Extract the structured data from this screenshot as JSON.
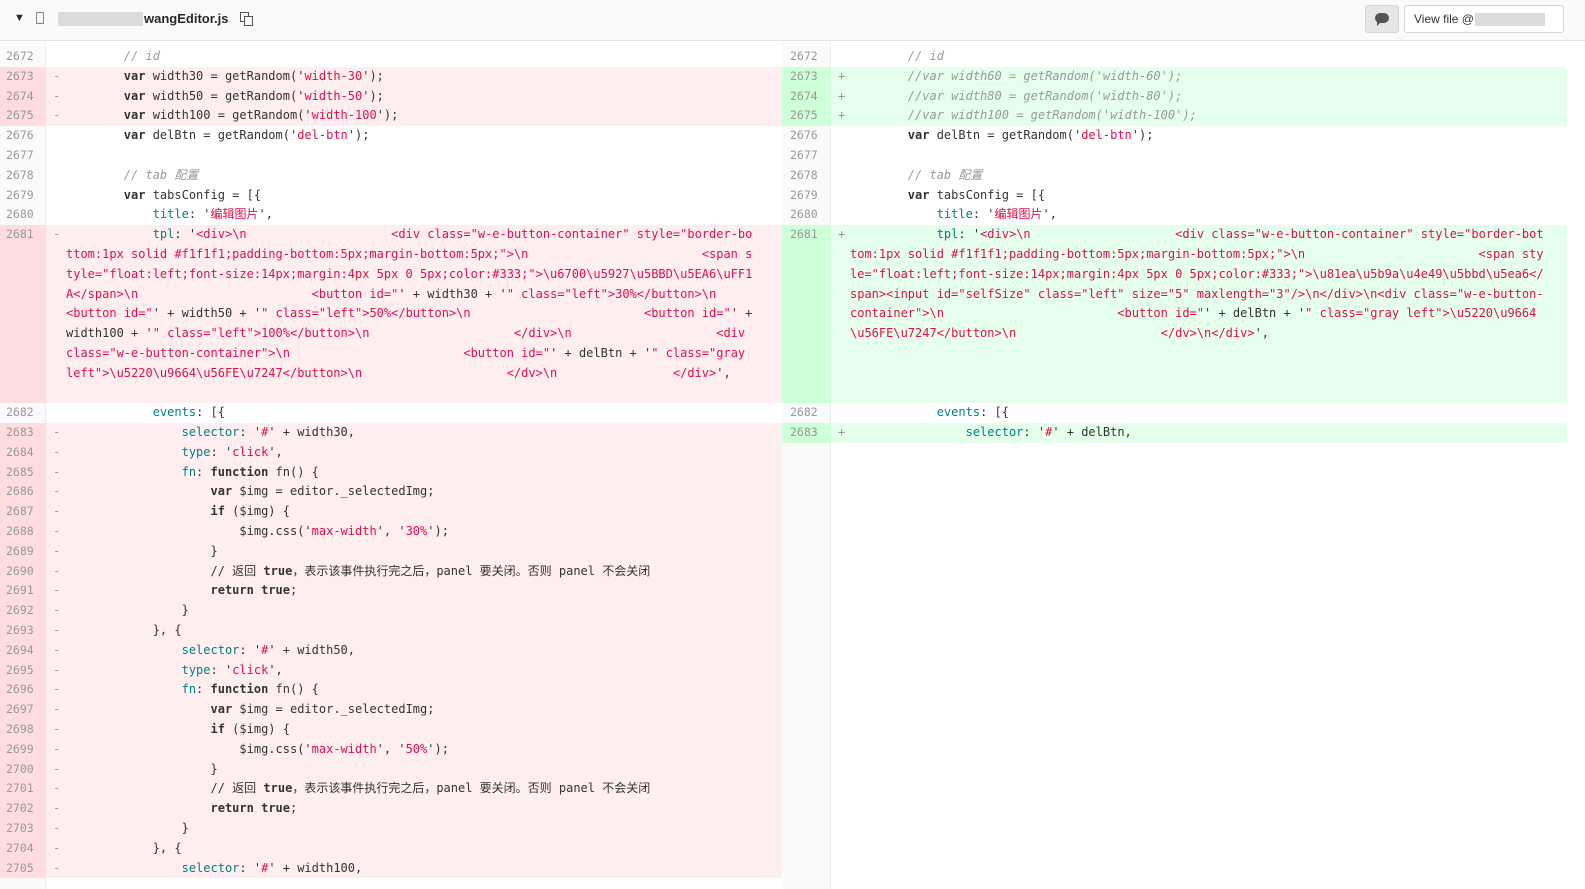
{
  "header": {
    "file_name": "wangEditor.js",
    "view_file_label": "View file @"
  },
  "left": {
    "rows_top": [
      {
        "n": "2672",
        "s": "",
        "t": "cm",
        "c": "        // id"
      },
      {
        "n": "2673",
        "s": "-",
        "t": "del",
        "c": "        var width30 = getRandom('width-30');"
      },
      {
        "n": "2674",
        "s": "-",
        "t": "del",
        "c": "        var width50 = getRandom('width-50');"
      },
      {
        "n": "2675",
        "s": "-",
        "t": "del",
        "c": "        var width100 = getRandom('width-100');"
      },
      {
        "n": "2676",
        "s": "",
        "t": "ctx",
        "c": "        var delBtn = getRandom('del-btn');"
      },
      {
        "n": "2677",
        "s": "",
        "t": "ctx",
        "c": ""
      },
      {
        "n": "2678",
        "s": "",
        "t": "cm",
        "c": "        // tab 配置"
      },
      {
        "n": "2679",
        "s": "",
        "t": "ctx",
        "c": "        var tabsConfig = [{"
      },
      {
        "n": "2680",
        "s": "",
        "t": "ctx",
        "c": "            title: '编辑图片',"
      }
    ],
    "block": {
      "n": "2681",
      "s": "-",
      "c": "            tpl: '<div>\\n                    <div class=\"w-e-button-container\" style=\"border-bottom:1px solid #f1f1f1;padding-bottom:5px;margin-bottom:5px;\">\\n                        <span style=\"float:left;font-size:14px;margin:4px 5px 0 5px;color:#333;\">\\u6700\\u5927\\u5BBD\\u5EA6\\uFF1A</span>\\n                        <button id=\"' + width30 + '\" class=\"left\">30%</button>\\n                        <button id=\"' + width50 + '\" class=\"left\">50%</button>\\n                        <button id=\"' + width100 + '\" class=\"left\">100%</button>\\n                    </div>\\n                    <div class=\"w-e-button-container\">\\n                        <button id=\"' + delBtn + '\" class=\"gray left\">\\u5220\\u9664\\u56FE\\u7247</button>\\n                    </dv>\\n                </div>',"
    },
    "rows_bottom": [
      {
        "n": "2682",
        "s": "",
        "t": "ctx",
        "c": "            events: [{"
      },
      {
        "n": "2683",
        "s": "-",
        "t": "del",
        "c": "                selector: '#' + width30,"
      },
      {
        "n": "2684",
        "s": "-",
        "t": "del",
        "c": "                type: 'click',"
      },
      {
        "n": "2685",
        "s": "-",
        "t": "del",
        "c": "                fn: function fn() {"
      },
      {
        "n": "2686",
        "s": "-",
        "t": "del",
        "c": "                    var $img = editor._selectedImg;"
      },
      {
        "n": "2687",
        "s": "-",
        "t": "del",
        "c": "                    if ($img) {"
      },
      {
        "n": "2688",
        "s": "-",
        "t": "del",
        "c": "                        $img.css('max-width', '30%');"
      },
      {
        "n": "2689",
        "s": "-",
        "t": "del",
        "c": "                    }"
      },
      {
        "n": "2690",
        "s": "-",
        "t": "del",
        "c": "                    // 返回 true，表示该事件执行完之后，panel 要关闭。否则 panel 不会关闭"
      },
      {
        "n": "2691",
        "s": "-",
        "t": "del",
        "c": "                    return true;"
      },
      {
        "n": "2692",
        "s": "-",
        "t": "del",
        "c": "                }"
      },
      {
        "n": "2693",
        "s": "-",
        "t": "del",
        "c": "            }, {"
      },
      {
        "n": "2694",
        "s": "-",
        "t": "del",
        "c": "                selector: '#' + width50,"
      },
      {
        "n": "2695",
        "s": "-",
        "t": "del",
        "c": "                type: 'click',"
      },
      {
        "n": "2696",
        "s": "-",
        "t": "del",
        "c": "                fn: function fn() {"
      },
      {
        "n": "2697",
        "s": "-",
        "t": "del",
        "c": "                    var $img = editor._selectedImg;"
      },
      {
        "n": "2698",
        "s": "-",
        "t": "del",
        "c": "                    if ($img) {"
      },
      {
        "n": "2699",
        "s": "-",
        "t": "del",
        "c": "                        $img.css('max-width', '50%');"
      },
      {
        "n": "2700",
        "s": "-",
        "t": "del",
        "c": "                    }"
      },
      {
        "n": "2701",
        "s": "-",
        "t": "del",
        "c": "                    // 返回 true，表示该事件执行完之后，panel 要关闭。否则 panel 不会关闭"
      },
      {
        "n": "2702",
        "s": "-",
        "t": "del",
        "c": "                    return true;"
      },
      {
        "n": "2703",
        "s": "-",
        "t": "del",
        "c": "                }"
      },
      {
        "n": "2704",
        "s": "-",
        "t": "del",
        "c": "            }, {"
      },
      {
        "n": "2705",
        "s": "-",
        "t": "del",
        "c": "                selector: '#' + width100,"
      }
    ]
  },
  "right": {
    "rows_top": [
      {
        "n": "2672",
        "s": "",
        "t": "cm",
        "c": "        // id"
      },
      {
        "n": "2673",
        "s": "+",
        "t": "addcm",
        "c": "        //var width60 = getRandom('width-60');"
      },
      {
        "n": "2674",
        "s": "+",
        "t": "addcm",
        "c": "        //var width80 = getRandom('width-80');"
      },
      {
        "n": "2675",
        "s": "+",
        "t": "addcm",
        "c": "        //var width100 = getRandom('width-100');"
      },
      {
        "n": "2676",
        "s": "",
        "t": "ctx",
        "c": "        var delBtn = getRandom('del-btn');"
      },
      {
        "n": "2677",
        "s": "",
        "t": "ctx",
        "c": ""
      },
      {
        "n": "2678",
        "s": "",
        "t": "cm",
        "c": "        // tab 配置"
      },
      {
        "n": "2679",
        "s": "",
        "t": "ctx",
        "c": "        var tabsConfig = [{"
      },
      {
        "n": "2680",
        "s": "",
        "t": "ctx",
        "c": "            title: '编辑图片',"
      }
    ],
    "block": {
      "n": "2681",
      "s": "+",
      "c": "            tpl: '<div>\\n                    <div class=\"w-e-button-container\" style=\"border-bottom:1px solid #f1f1f1;padding-bottom:5px;margin-bottom:5px;\">\\n                        <span style=\"float:left;font-size:14px;margin:4px 5px 0 5px;color:#333;\">\\u81ea\\u5b9a\\u4e49\\u5bbd\\u5ea6</span><input id=\"selfSize\" class=\"left\" size=\"5\" maxlength=\"3\"/>\\n</div>\\n<div class=\"w-e-button-container\">\\n                        <button id=\"' + delBtn + '\" class=\"gray left\">\\u5220\\u9664\\u56FE\\u7247</button>\\n                    </dv>\\n</div>',"
    },
    "rows_bottom": [
      {
        "n": "2682",
        "s": "",
        "t": "ctx",
        "c": "            events: [{"
      },
      {
        "n": "2683",
        "s": "+",
        "t": "add",
        "c": "                selector: '#' + delBtn,"
      }
    ]
  }
}
